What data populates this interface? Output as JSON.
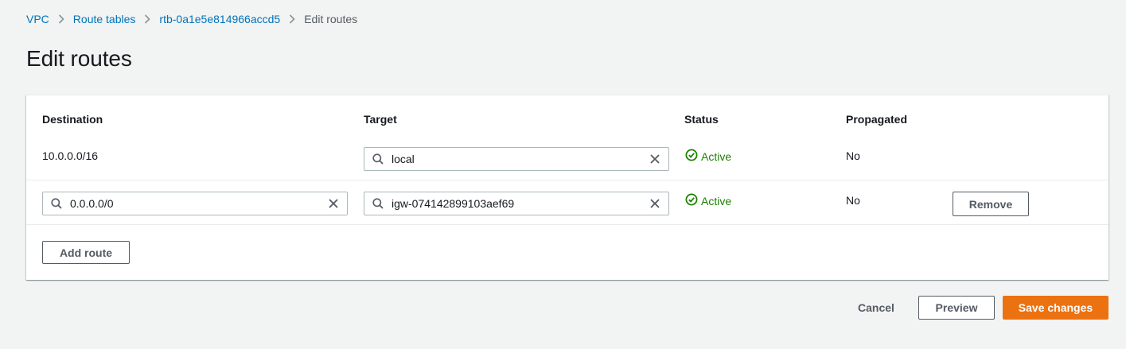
{
  "breadcrumb": {
    "items": [
      {
        "label": "VPC"
      },
      {
        "label": "Route tables"
      },
      {
        "label": "rtb-0a1e5e814966accd5"
      },
      {
        "label": "Edit routes"
      }
    ]
  },
  "page": {
    "title": "Edit routes"
  },
  "table": {
    "columns": {
      "destination": "Destination",
      "target": "Target",
      "status": "Status",
      "propagated": "Propagated"
    },
    "rows": [
      {
        "destination": "10.0.0.0/16",
        "target": "local",
        "status": "Active",
        "propagated": "No"
      },
      {
        "destination": "0.0.0.0/0",
        "target": "igw-074142899103aef69",
        "status": "Active",
        "propagated": "No",
        "remove_label": "Remove"
      }
    ],
    "add_route_label": "Add route"
  },
  "actions": {
    "cancel_label": "Cancel",
    "preview_label": "Preview",
    "save_label": "Save changes"
  },
  "colors": {
    "link": "#0073bb",
    "status_active": "#1d8102",
    "primary": "#ec7211"
  },
  "icons": {
    "breadcrumb_separator": "chevron-right-icon",
    "input_search": "search-icon",
    "input_clear": "close-icon",
    "status": "status-positive-icon"
  }
}
